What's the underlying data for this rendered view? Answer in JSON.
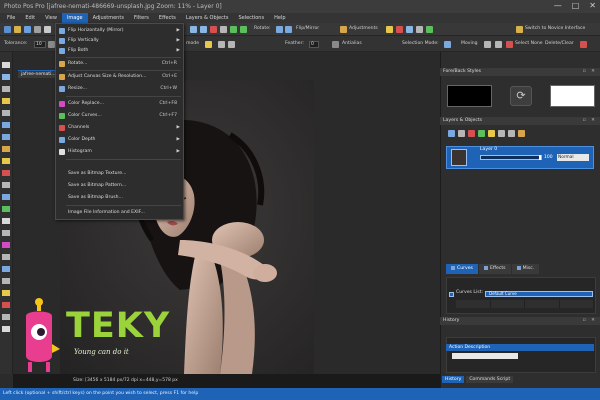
{
  "window": {
    "title": "Photo Pos Pro [jafree-nemati-486669-unsplash.jpg Zoom: 11% - Layer 0]",
    "buttons": [
      "—",
      "□",
      "✕"
    ]
  },
  "menubar": {
    "items": [
      "File",
      "Edit",
      "View",
      "Image",
      "Adjustments",
      "Filters",
      "Effects",
      "Layers & Objects",
      "Selections",
      "Help"
    ],
    "active": "Image"
  },
  "toolbar1": {
    "rotate": "Rotate:",
    "flip_mirror": "Flip/Mirror",
    "adjustments": "Adjustments",
    "switch_novice": "Switch to Novice Interface"
  },
  "toolbar2": {
    "tolerance_label": "Tolerance:",
    "tolerance_value": "10",
    "mode": "mode",
    "feather_label": "Feather:",
    "feather_value": "0",
    "antialias": "Antialias",
    "selection_mode": "Selection Mode:",
    "moving": "Moving",
    "select_none": "Select None",
    "delete_clear": "Delete/Clear"
  },
  "document": {
    "tab_label": "jafree-nemati..."
  },
  "image_menu": {
    "items": [
      {
        "label": "Flip Horizontally (Mirror)",
        "shortcut": "",
        "submenu": true,
        "icon": "flip-horizontal-icon",
        "color": "#7aa9e0"
      },
      {
        "label": "Flip Vertically",
        "shortcut": "",
        "submenu": true,
        "icon": "flip-vertical-icon",
        "color": "#7aa9e0"
      },
      {
        "label": "Flip Both",
        "shortcut": "",
        "submenu": true,
        "icon": "flip-both-icon",
        "color": "#7aa9e0"
      },
      {
        "label": "Rotate...",
        "shortcut": "Ctrl+R",
        "submenu": false,
        "icon": "rotate-icon",
        "color": "#d8a64a"
      },
      {
        "label": "Adjust Canvas Size & Resolution...",
        "shortcut": "Ctrl+E",
        "submenu": false,
        "icon": "canvas-size-icon",
        "color": "#d8a64a"
      },
      {
        "label": "Resize...",
        "shortcut": "Ctrl+W",
        "submenu": false,
        "icon": "resize-icon",
        "color": "#7aa9e0"
      },
      {
        "label": "Color Replace...",
        "shortcut": "Ctrl+F8",
        "submenu": false,
        "icon": "color-replace-icon",
        "color": "#d04bc4"
      },
      {
        "label": "Color Curves...",
        "shortcut": "Ctrl+F7",
        "submenu": false,
        "icon": "color-curves-icon",
        "color": "#5bbf5b"
      },
      {
        "label": "Channels",
        "shortcut": "",
        "submenu": true,
        "icon": "channels-icon",
        "color": "#d65050"
      },
      {
        "label": "Color Depth",
        "shortcut": "",
        "submenu": true,
        "icon": "color-depth-icon",
        "color": "#7aa9e0"
      },
      {
        "label": "Histogram",
        "shortcut": "",
        "submenu": true,
        "icon": "histogram-icon",
        "color": "#e0e0e0"
      },
      {
        "label": "Save as Bitmap Texture...",
        "shortcut": "",
        "submenu": false,
        "icon": "",
        "color": ""
      },
      {
        "label": "Save as Bitmap Pattern...",
        "shortcut": "",
        "submenu": false,
        "icon": "",
        "color": ""
      },
      {
        "label": "Save as Bitmap Brush...",
        "shortcut": "",
        "submenu": false,
        "icon": "",
        "color": ""
      },
      {
        "label": "Image File Information and EXIF...",
        "shortcut": "",
        "submenu": false,
        "icon": "",
        "color": ""
      }
    ]
  },
  "panels": {
    "fore_back_title": "Fore/Back Styles",
    "layers_title": "Layers & Objects",
    "layer": {
      "name": "Layer 0",
      "opacity": "100",
      "blend_mode": "Normal"
    },
    "tabs": [
      "Curves",
      "Effects",
      "Misc."
    ],
    "active_tab": "Curves",
    "curves_label": "Curves List:",
    "curves_value": "Default Curve",
    "history_title": "History",
    "history_item": "Action Description",
    "bottom_tabs": [
      "History",
      "Commands Script"
    ]
  },
  "status": {
    "info": "Size: [3456 x 5184 px/72 dpi   x=448,y=578 px",
    "hint": "Left click (optional + shift/ctrl keys) on the point you wish to select, press F1 for help"
  },
  "watermark": {
    "brand": "TEKY",
    "slogan": "Young can do it"
  },
  "colors": {
    "accent": "#1e63b5",
    "brand_green": "#9bd33a",
    "logo_pink": "#e93e8f",
    "logo_yellow": "#f5c518"
  }
}
